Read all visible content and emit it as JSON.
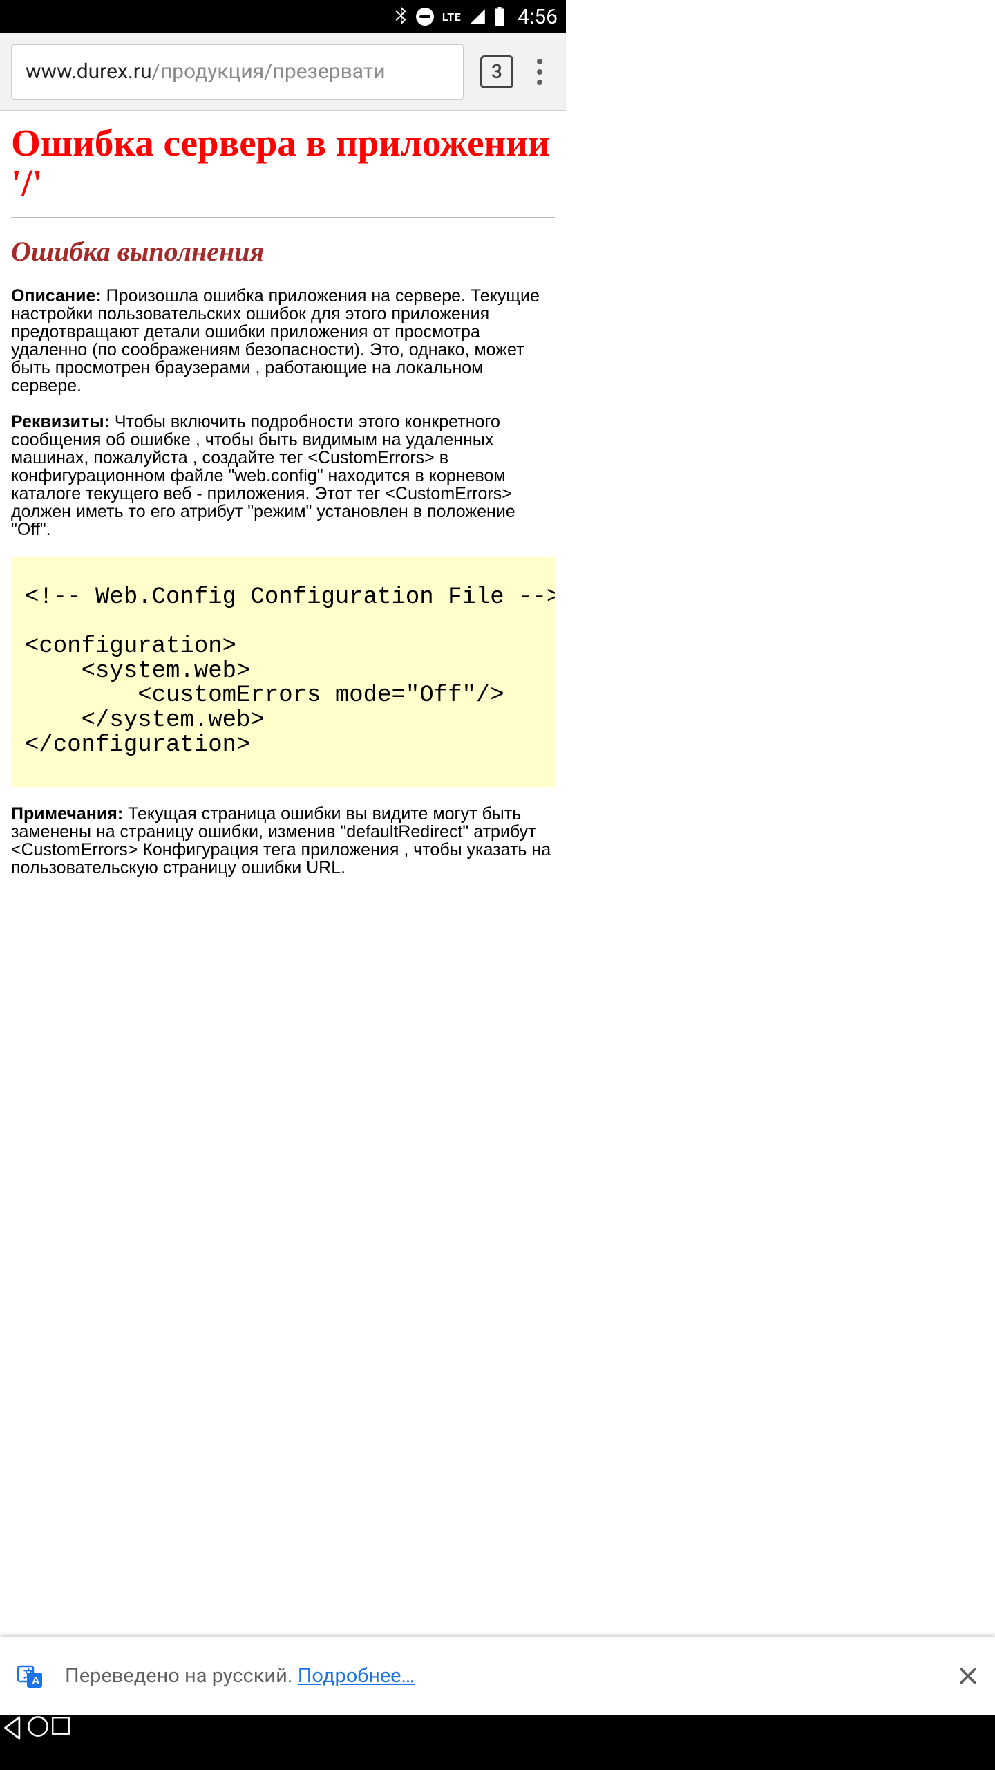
{
  "status_bar": {
    "lte_label": "LTE",
    "time": "4:56"
  },
  "browser": {
    "url_domain": "www.durex.ru",
    "url_path": "/продукция/презервати",
    "tab_count": "3"
  },
  "page": {
    "title": "Ошибка сервера в приложении '/'",
    "subtitle": "Ошибка выполнения",
    "description_label": "Описание:",
    "description_text": " Произошла ошибка приложения на сервере. Текущие настройки пользовательских ошибок для этого приложения предотвращают детали ошибки приложения от просмотра удаленно (по соображениям безопасности). Это, однако, может быть просмотрен браузерами , работающие на локальном сервере.",
    "details_label": "Реквизиты:",
    "details_text": " Чтобы включить подробности этого конкретного сообщения об ошибке , чтобы быть видимым на удаленных машинах, пожалуйста , создайте тег <CustomErrors> в конфигурационном файле \"web.config\" находится в корневом каталоге текущего веб - приложения. Этот тег <CustomErrors> должен иметь то его атрибут \"режим\" установлен в положение \"Off\".",
    "code": "<!-- Web.Config Configuration File -->\n\n<configuration>\n    <system.web>\n        <customErrors mode=\"Off\"/>\n    </system.web>\n</configuration>",
    "notes_label": "Примечания:",
    "notes_text": " Текущая страница ошибки вы видите могут быть заменены на страницу ошибки, изменив \"defaultRedirect\" атрибут <CustomErrors> Конфигурация тега приложения , чтобы указать на пользовательскую страницу ошибки URL."
  },
  "translate": {
    "text": "Переведено на русский. ",
    "link": "Подробнее…"
  }
}
